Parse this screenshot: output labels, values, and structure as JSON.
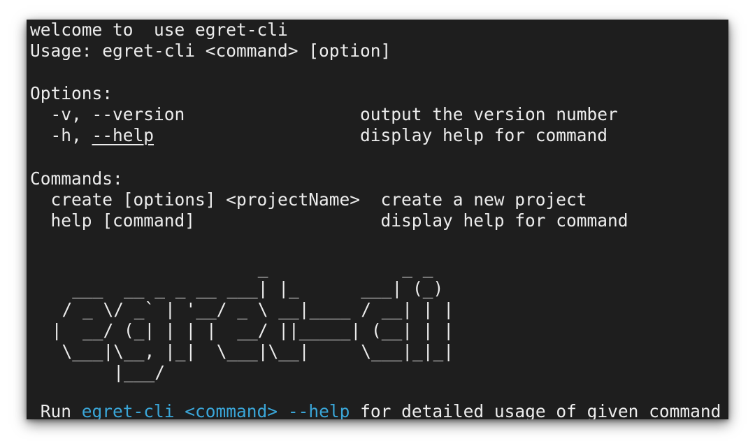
{
  "terminal": {
    "welcome": "welcome to  use egret-cli",
    "usage": "Usage: egret-cli <command> [option]",
    "options_heading": "Options:",
    "options": [
      {
        "flag_prefix": "  -v, ",
        "flag_main": "--version",
        "pad": "                 ",
        "description": "output the version number"
      },
      {
        "flag_prefix": "  -h, ",
        "flag_main": "--help",
        "pad": "                    ",
        "description": "display help for command"
      }
    ],
    "commands_heading": "Commands:",
    "commands": [
      {
        "command": "  create [options] <projectName>  ",
        "description": "create a new project"
      },
      {
        "command": "  help [command]                  ",
        "description": "display help for command"
      }
    ],
    "ascii_art": "                     _             _ _ \n   ___  __ _ _ __ ___| |_      ___| (_)\n  / _ \\/ _` | '__/ _ \\ __|____ / __| | |\n |  __/ (_| | | |  __/ ||_____| (__| | |\n  \\___|\\__, |_|  \\___|\\__|     \\___|_|_|\n       |___/                           ",
    "footer": {
      "run": " Run ",
      "cmd1": "egret-cli",
      "space1": " ",
      "cmd2": "<command>",
      "space2": " ",
      "cmd3": "--help",
      "rest": " for detailed usage of given command"
    }
  }
}
